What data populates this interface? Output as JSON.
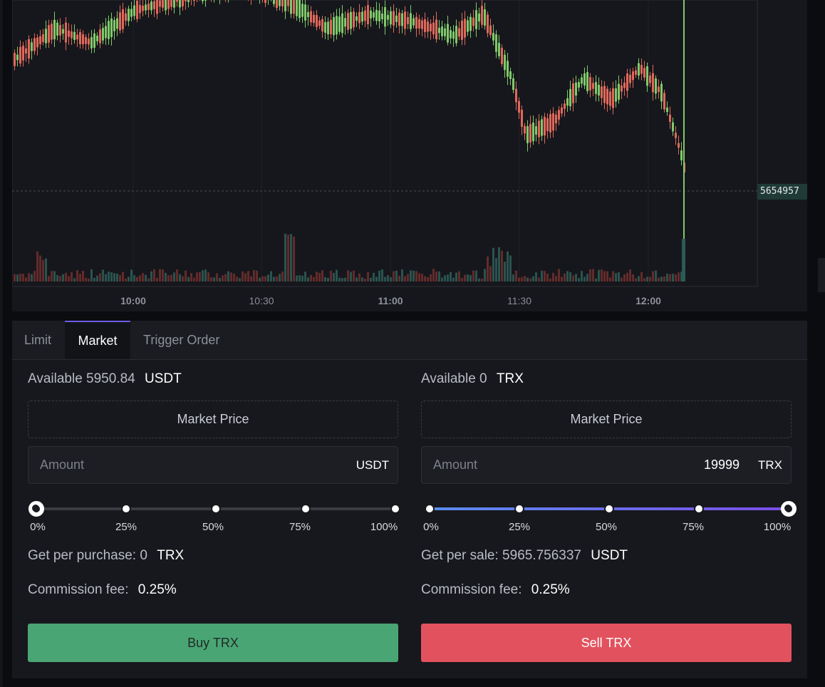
{
  "colors": {
    "up": "#7fc96a",
    "down": "#e0685b",
    "buy": "#4aa574",
    "sell": "#e2525e",
    "accent": "#6c5ce7"
  },
  "chart": {
    "last_price_label": "5654957",
    "time_labels": [
      "10:00",
      "10:30",
      "11:00",
      "11:30",
      "12:00"
    ]
  },
  "tabs": [
    "Limit",
    "Market",
    "Trigger Order"
  ],
  "active_tab": "Market",
  "buy": {
    "available_label": "Available",
    "available_value": "5950.84",
    "available_unit": "USDT",
    "market_price": "Market Price",
    "amount_placeholder": "Amount",
    "amount_value": "",
    "amount_unit": "USDT",
    "slider_percent": 0,
    "slider_labels": [
      "0%",
      "25%",
      "50%",
      "75%",
      "100%"
    ],
    "get_label": "Get per purchase: 0",
    "get_unit": "TRX",
    "fee_label": "Commission fee:",
    "fee_value": "0.25%",
    "button": "Buy TRX"
  },
  "sell": {
    "available_label": "Available",
    "available_value": "0",
    "available_unit": "TRX",
    "market_price": "Market Price",
    "amount_placeholder": "Amount",
    "amount_value": "19999",
    "amount_unit": "TRX",
    "slider_percent": 100,
    "slider_labels": [
      "0%",
      "25%",
      "50%",
      "75%",
      "100%"
    ],
    "get_label": "Get per sale: 5965.756337",
    "get_unit": "USDT",
    "fee_label": "Commission fee:",
    "fee_value": "0.25%",
    "button": "Sell TRX"
  }
}
